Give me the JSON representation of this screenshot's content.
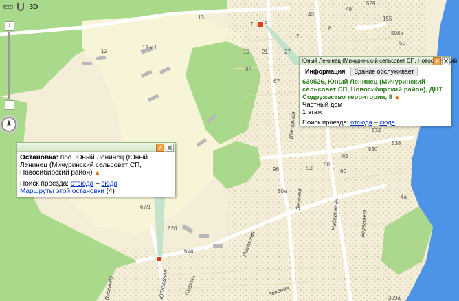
{
  "toolbar": {
    "ruler_icon": "ruler-icon",
    "magnet_icon": "magnet-icon",
    "mode_3d_label": "3D"
  },
  "zoom": {
    "plus": "+",
    "minus": "−"
  },
  "compass_icon": "compass-icon",
  "colors": {
    "land": "#f4eed8",
    "forest": "#a9d98a",
    "river": "#4d94e8",
    "sand_area": "#f7f4d8",
    "dots": "#c8c0a0",
    "popup_accent": "#2e7d1e",
    "link": "#0033cc",
    "pin": "#e53a0c"
  },
  "map_labels": {
    "n13": "13",
    "n12x1": "12 к.1",
    "n12": "12",
    "n43": "43",
    "n49": "49",
    "n7": "7",
    "n9": "9",
    "n19": "19",
    "n21": "21",
    "n27": "27",
    "n35": "35",
    "n67": "67",
    "n96": "96",
    "n92": "92",
    "n60": "60",
    "n41": "4/1",
    "n60a": "60а",
    "n671": "67/1",
    "n62b": "62б",
    "n62a": "62а",
    "n532": "532",
    "n538": "538",
    "n530": "530",
    "n529": "529",
    "n155": "155",
    "n508a": "508а",
    "n4a": "4а",
    "n399a": "399а",
    "n60b": "60",
    "n6": "6",
    "n2": "2",
    "n50": "50"
  },
  "streets": {
    "zelenaya1": "Зелёная",
    "zelenaya2": "Зелёная",
    "ishimskaya": "Ишимская",
    "noboevaya": "Набережная",
    "beregovaya": "Береговая",
    "yubileynaya": "Юбилейная",
    "vesennyaya": "Весенняя",
    "gagrina": "Гагрина",
    "chastnaya": "Шатурная"
  },
  "stop_popup": {
    "label": "Остановка:",
    "name": "пос. Юный Ленинец (Юный Ленинец (Мичуринский сельсовет СП, Новосибирский район)",
    "route_label": "Поиск проезда:",
    "from_here": "отсюда",
    "dash": "–",
    "to_here": "сюда",
    "routes_link": "Маршруты этой остановки",
    "routes_count": "(4)"
  },
  "house_popup": {
    "title": "Юный Ленинец (Мичуринский сельсовет СП, Новосибирский",
    "tab_info": "Информация",
    "tab_building": "Здание обслуживает",
    "address": "630526, Юный Ленинец (Мичуринский сельсовет СП, Новосибирский район), ДНТ Содружество территория, 8",
    "type": "Частный дом",
    "floors": "1 этаж",
    "route_label": "Поиск проезда:",
    "from_here": "отсюда",
    "dash": "–",
    "to_here": "сюда"
  },
  "pin_label": "9"
}
